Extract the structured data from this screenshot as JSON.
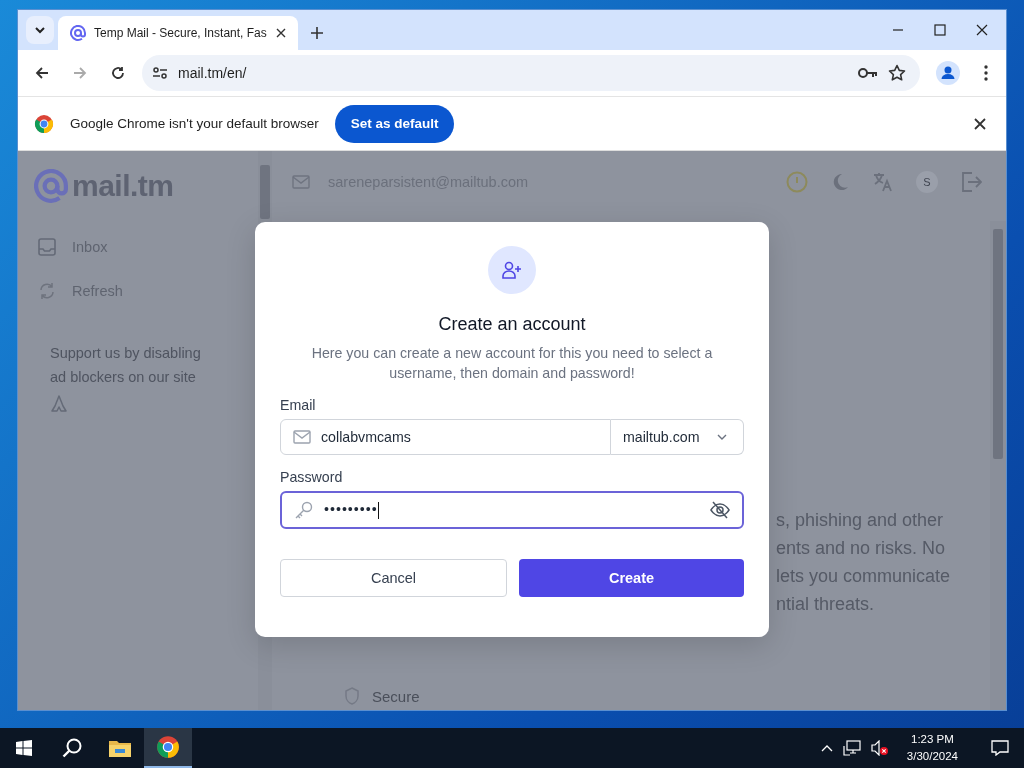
{
  "tabs": [
    {
      "title": "Temp Mail - Secure, Instant, Fas",
      "selected": true
    }
  ],
  "address_bar": {
    "url": "mail.tm/en/"
  },
  "infobar": {
    "message": "Google Chrome isn't your default browser",
    "button": "Set as default"
  },
  "page": {
    "logo": "mail.tm",
    "sidebar": {
      "items": [
        {
          "label": "Inbox",
          "kind": "inbox"
        },
        {
          "label": "Refresh",
          "kind": "refresh"
        }
      ],
      "support_text": "Support us by disabling ad blockers on our site"
    },
    "header": {
      "email": "sareneparsistent@mailtub.com",
      "avatar": "S"
    },
    "background_lines": [
      "s, phishing and other",
      "ents and no risks. No",
      "lets you communicate",
      "ntial threats."
    ],
    "footer_item": "Secure"
  },
  "dialog": {
    "title": "Create an account",
    "description": "Here you can create a new account for this you need to select a username, then domain and password!",
    "email": {
      "label": "Email",
      "value": "collabvmcams",
      "domain": "mailtub.com"
    },
    "password": {
      "label": "Password",
      "value": "•••••••••",
      "focused": true
    },
    "buttons": [
      {
        "label": "Cancel",
        "kind": "secondary"
      },
      {
        "label": "Create",
        "kind": "primary"
      }
    ]
  },
  "taskbar": {
    "time": "1:23 PM",
    "date": "3/30/2024"
  }
}
